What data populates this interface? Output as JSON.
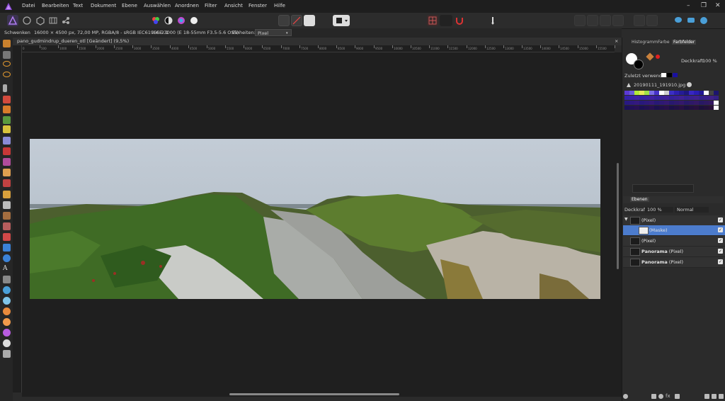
{
  "menu": [
    "Datei",
    "Bearbeiten",
    "Text",
    "Dokument",
    "Ebene",
    "Auswählen",
    "Anordnen",
    "Filter",
    "Ansicht",
    "Fenster",
    "Hilfe"
  ],
  "window_controls": {
    "minimize": "–",
    "restore": "❐",
    "close": "✕"
  },
  "context_bar": {
    "tool": "Schwenken",
    "doc_info": "16000 × 4500 px, 72,00 MP, RGBA/8 - sRGB IEC61966-2.1",
    "camera": "ILCE-3000 (E 18-55mm F3.5-5.6 OSS)",
    "units_label": "Einheiten:",
    "units_value": "Pixel"
  },
  "document_tab": {
    "title": "pano_gudmindrup_dueren_otl [Geändert] (9,5%)",
    "close": "×"
  },
  "ruler_labels": [
    "0",
    "500",
    "1000",
    "1500",
    "2000",
    "2500",
    "3000",
    "3500",
    "4000",
    "4500",
    "5000",
    "5500",
    "6000",
    "6500",
    "7000",
    "7500",
    "8000",
    "8500",
    "9000",
    "9500",
    "10000",
    "10500",
    "11000",
    "11500",
    "12000",
    "12500",
    "13000",
    "13500",
    "14000",
    "14500",
    "15000",
    "15500",
    "16000"
  ],
  "panel_top": {
    "tabs": [
      "Histogramm",
      "Farbe",
      "Farbfelder"
    ],
    "active_tab": "Farbfelder",
    "opacity_label": "Deckkraft:",
    "opacity_value": "100 %",
    "recent_label": "Zuletzt verwendet:",
    "palette_name": "20190111_191910.jpg"
  },
  "layers_panel": {
    "tab": "Ebenen",
    "opacity_label": "Deckkraft:",
    "opacity_value": "100 %",
    "blend_mode": "Normal",
    "layers": [
      {
        "name_bold": "",
        "name": "(Pixel)",
        "selected": false,
        "indent": false
      },
      {
        "name_bold": "",
        "name": "(Maske)",
        "selected": true,
        "indent": true
      },
      {
        "name_bold": "",
        "name": "(Pixel)",
        "selected": false,
        "indent": false
      },
      {
        "name_bold": "Panorama",
        "name": " (Pixel)",
        "selected": false,
        "indent": false
      },
      {
        "name_bold": "Panorama",
        "name": " (Pixel)",
        "selected": false,
        "indent": false
      }
    ]
  },
  "colors": {
    "accent": "#4c7ccd",
    "background": "#1f1f1f",
    "panel": "#2b2b2b"
  }
}
